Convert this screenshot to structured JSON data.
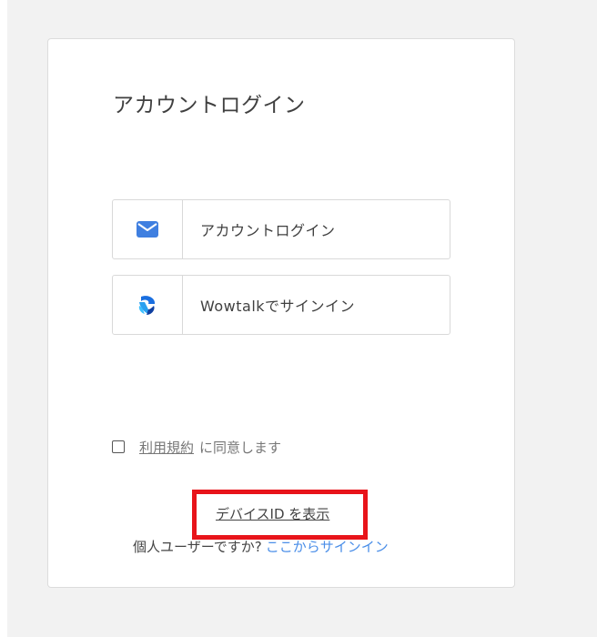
{
  "page": {
    "title": "アカウントログイン"
  },
  "buttons": {
    "account_login_label": "アカウントログイン",
    "wowtalk_label": "Wowtalkでサインイン"
  },
  "terms": {
    "link_text": "利用規約",
    "suffix_text": "に同意します",
    "checked": false
  },
  "footer": {
    "device_id_link": "デバイスID を表示",
    "personal_question": "個人ユーザーですか?",
    "personal_link": "ここからサインイン"
  },
  "colors": {
    "accent_blue": "#4a8ee8",
    "mail_icon_blue": "#3f7fe0",
    "highlight_red": "#e8141a",
    "background_gray": "#f2f2f2"
  },
  "icons": {
    "account_login": "mail-icon",
    "wowtalk": "wowtalk-logo-icon"
  }
}
